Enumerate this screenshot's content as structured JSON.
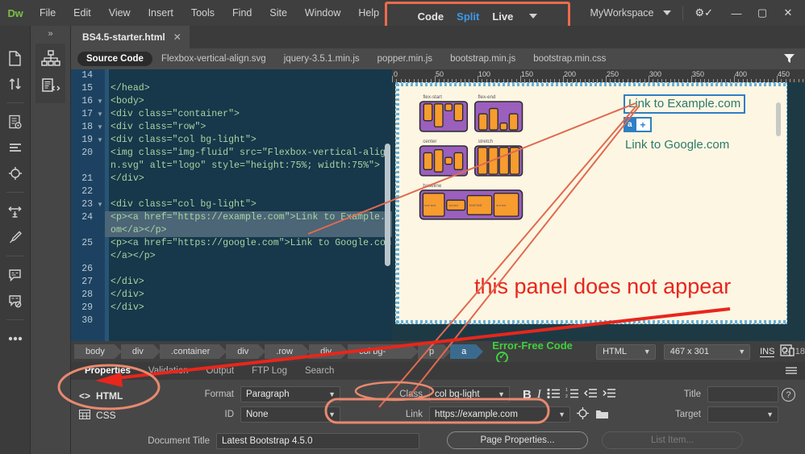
{
  "app": {
    "logo": "Dw",
    "menus": [
      "File",
      "Edit",
      "View",
      "Insert",
      "Tools",
      "Find",
      "Site",
      "Window",
      "Help"
    ],
    "workspace": "MyWorkspace",
    "window_buttons": [
      "—",
      "▢",
      "✕"
    ]
  },
  "mode_switch": {
    "items": [
      {
        "label": "Code",
        "active": false
      },
      {
        "label": "Split",
        "active": true
      },
      {
        "label": "Live",
        "active": false
      }
    ]
  },
  "document_tabs": [
    {
      "label": "BS4.5-starter.html",
      "close": "✕"
    }
  ],
  "related_files": [
    {
      "label": "Source Code",
      "active": true
    },
    {
      "label": "Flexbox-vertical-align.svg",
      "active": false
    },
    {
      "label": "jquery-3.5.1.min.js",
      "active": false
    },
    {
      "label": "popper.min.js",
      "active": false
    },
    {
      "label": "bootstrap.min.js",
      "active": false
    },
    {
      "label": "bootstrap.min.css",
      "active": false
    }
  ],
  "code": {
    "lines": [
      {
        "num": "14",
        "fold": false,
        "text": ""
      },
      {
        "num": "15",
        "fold": false,
        "text": "</head>"
      },
      {
        "num": "16",
        "fold": true,
        "text": "<body>"
      },
      {
        "num": "17",
        "fold": true,
        "text": "<div class=\"container\">"
      },
      {
        "num": "18",
        "fold": true,
        "text": "<div class=\"row\">"
      },
      {
        "num": "19",
        "fold": true,
        "text": "<div class=\"col bg-light\">"
      },
      {
        "num": "20",
        "fold": false,
        "text": "<img class=\"img-fluid\" src=\"Flexbox-vertical-align.svg\" alt=\"logo\" style=\"height:75%; width:75%\">"
      },
      {
        "num": "21",
        "fold": false,
        "text": "</div>"
      },
      {
        "num": "22",
        "fold": false,
        "text": ""
      },
      {
        "num": "23",
        "fold": true,
        "text": "<div class=\"col bg-light\">"
      },
      {
        "num": "24",
        "fold": false,
        "text": "<p><a href=\"https://example.com\">Link to Example.com</a></p>"
      },
      {
        "num": "25",
        "fold": false,
        "text": "<p><a href=\"https://google.com\">Link to Google.com</a></p>"
      },
      {
        "num": "26",
        "fold": false,
        "text": ""
      },
      {
        "num": "27",
        "fold": false,
        "text": "</div>"
      },
      {
        "num": "28",
        "fold": false,
        "text": "</div>"
      },
      {
        "num": "29",
        "fold": false,
        "text": "</div>"
      },
      {
        "num": "30",
        "fold": false,
        "text": ""
      }
    ]
  },
  "live_view": {
    "ruler_marks": [
      "0",
      "50",
      "100",
      "150",
      "200",
      "250",
      "300",
      "350",
      "400",
      "450"
    ],
    "svg_labels": [
      "flex-start",
      "flex-end",
      "center",
      "stretch",
      "baseline"
    ],
    "svg_text_cells": [
      "text text",
      "text text",
      "text text",
      "text text"
    ],
    "link_example": "Link to Example.com",
    "link_google": "Link to Google.com",
    "hud_tag": "a",
    "hud_plus": "+"
  },
  "annotation": {
    "text": "this panel does not appear",
    "color": "#e8261c",
    "highlight_color": "#ef6a4d"
  },
  "status_bar": {
    "tags": [
      {
        "label": "body",
        "selected": false
      },
      {
        "label": "div",
        "selected": false
      },
      {
        "label": ".container",
        "selected": false
      },
      {
        "label": "div",
        "selected": false
      },
      {
        "label": ".row",
        "selected": false
      },
      {
        "label": "div",
        "selected": false
      },
      {
        "label": "col bg-light",
        "selected": false
      },
      {
        "label": "p",
        "selected": false
      },
      {
        "label": "a",
        "selected": true
      }
    ],
    "error_free": "Error-Free Code",
    "doctype": "HTML",
    "size": "467 x 301",
    "ins": "INS",
    "linecol": "24:18"
  },
  "properties": {
    "tabs": [
      {
        "label": "Properties",
        "active": true
      },
      {
        "label": "Validation",
        "active": false
      },
      {
        "label": "Output",
        "active": false
      },
      {
        "label": "FTP Log",
        "active": false
      },
      {
        "label": "Search",
        "active": false
      }
    ],
    "mode_html": "HTML",
    "mode_css": "CSS",
    "format_label": "Format",
    "format_value": "Paragraph",
    "id_label": "ID",
    "id_value": "None",
    "class_label": "Class",
    "class_value": "col bg-light",
    "link_label": "Link",
    "link_value": "https://example.com",
    "title_label": "Title",
    "title_value": "",
    "target_label": "Target",
    "target_value": "",
    "document_title_label": "Document Title",
    "document_title_value": "Latest Bootstrap 4.5.0",
    "page_properties_button": "Page Properties...",
    "list_item_button": "List Item...",
    "bold": "B",
    "italic": "I",
    "help": "?"
  }
}
